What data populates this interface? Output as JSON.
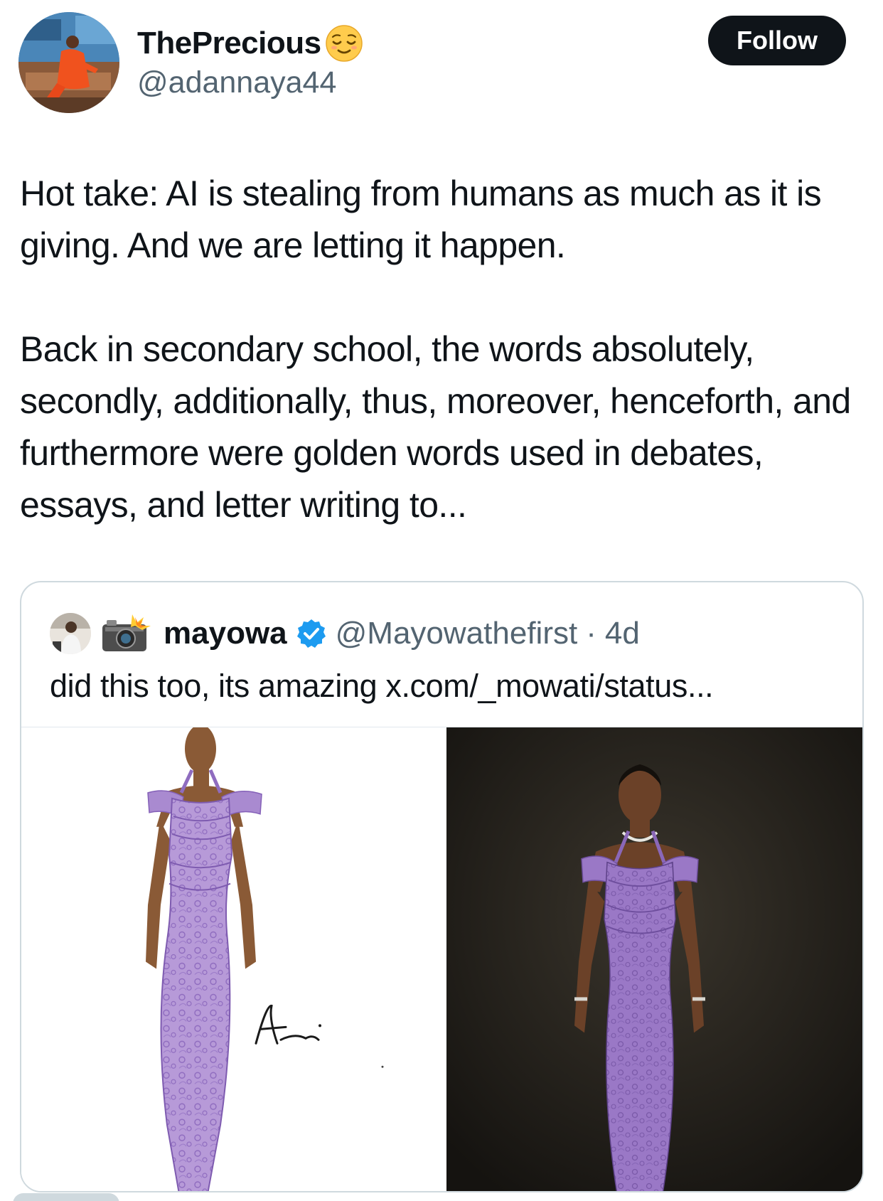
{
  "author": {
    "display_name": "ThePrecious",
    "status_emoji": "relieved-face-emoji",
    "handle": "@adannaya44",
    "avatar": "profile-photo-woman-orange-dress"
  },
  "follow_button": {
    "label": "Follow"
  },
  "tweet": {
    "paragraphs": [
      "Hot take: AI is stealing from humans as much as it is giving. And we are letting it happen.",
      "Back in secondary school, the words absolutely, secondly, additionally, thus, moreover, henceforth, and furthermore were golden words used in debates, essays, and letter writing to..."
    ]
  },
  "quoted_tweet": {
    "avatar": "profile-photo-man-white-outfit",
    "name_prefix_emoji": "camera-with-flash-emoji",
    "name": "mayowa",
    "verified": true,
    "handle": "@Mayowathefirst",
    "separator": "·",
    "age": "4d",
    "text": "did this too, its amazing x.com/_mowati/status...",
    "media": [
      {
        "type": "image",
        "description_name": "fashion-sketch-purple-lace-gown",
        "signature": "Asanu"
      },
      {
        "type": "image",
        "description_name": "ai-render-model-purple-lace-gown"
      }
    ]
  },
  "colors": {
    "text_primary": "#0f1419",
    "text_secondary": "#536471",
    "border": "#cfd9de",
    "button_bg": "#0f1419",
    "verified_blue": "#1d9bf0",
    "gown_purple": "#9b7cc4"
  }
}
